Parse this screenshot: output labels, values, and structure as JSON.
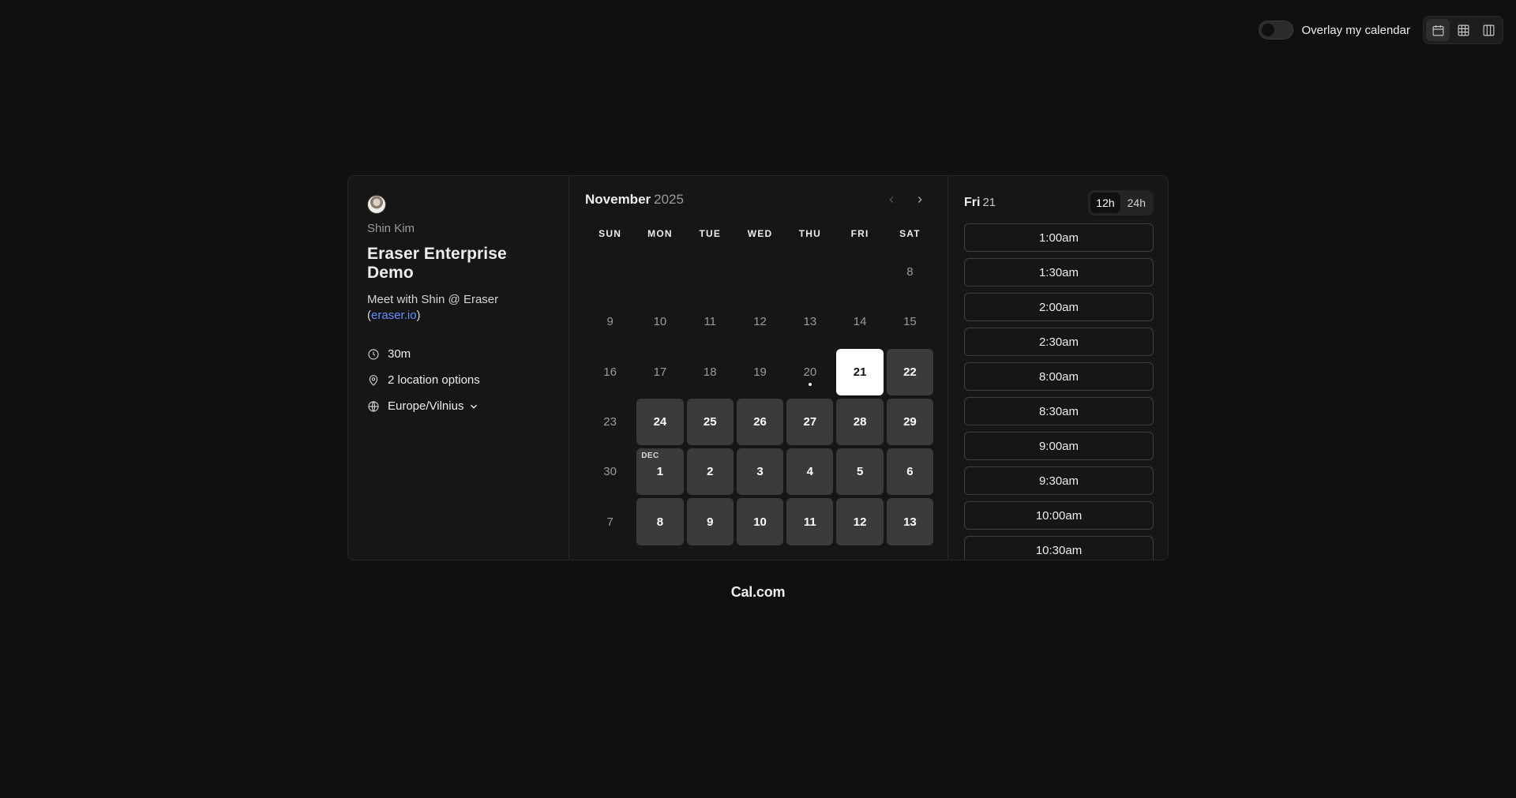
{
  "topbar": {
    "overlay_label": "Overlay my calendar",
    "overlay_enabled": false,
    "views": [
      {
        "icon": "calendar-icon",
        "active": true
      },
      {
        "icon": "grid-icon",
        "active": false
      },
      {
        "icon": "columns-icon",
        "active": false
      }
    ]
  },
  "meta": {
    "host_name": "Shin Kim",
    "event_title": "Eraser Enterprise Demo",
    "description_text": "Meet with Shin @ Eraser (",
    "description_link": "eraser.io",
    "description_end": ")",
    "duration": "30m",
    "locations": "2 location options",
    "timezone": "Europe/Vilnius"
  },
  "calendar": {
    "month": "November",
    "year": "2025",
    "weekdays": [
      "SUN",
      "MON",
      "TUE",
      "WED",
      "THU",
      "FRI",
      "SAT"
    ],
    "weeks": [
      [
        null,
        null,
        null,
        null,
        null,
        null,
        {
          "d": "8",
          "s": "off"
        }
      ],
      [
        {
          "d": "9",
          "s": "off"
        },
        {
          "d": "10",
          "s": "off"
        },
        {
          "d": "11",
          "s": "off"
        },
        {
          "d": "12",
          "s": "off"
        },
        {
          "d": "13",
          "s": "off"
        },
        {
          "d": "14",
          "s": "off"
        },
        {
          "d": "15",
          "s": "off"
        }
      ],
      [
        {
          "d": "16",
          "s": "off"
        },
        {
          "d": "17",
          "s": "off"
        },
        {
          "d": "18",
          "s": "off"
        },
        {
          "d": "19",
          "s": "off"
        },
        {
          "d": "20",
          "s": "off",
          "today": true
        },
        {
          "d": "21",
          "s": "selected"
        },
        {
          "d": "22",
          "s": "available"
        }
      ],
      [
        {
          "d": "23",
          "s": "off"
        },
        {
          "d": "24",
          "s": "available"
        },
        {
          "d": "25",
          "s": "available"
        },
        {
          "d": "26",
          "s": "available"
        },
        {
          "d": "27",
          "s": "available"
        },
        {
          "d": "28",
          "s": "available"
        },
        {
          "d": "29",
          "s": "available"
        }
      ],
      [
        {
          "d": "30",
          "s": "off"
        },
        {
          "d": "1",
          "s": "available",
          "tag": "DEC"
        },
        {
          "d": "2",
          "s": "available"
        },
        {
          "d": "3",
          "s": "available"
        },
        {
          "d": "4",
          "s": "available"
        },
        {
          "d": "5",
          "s": "available"
        },
        {
          "d": "6",
          "s": "available"
        }
      ],
      [
        {
          "d": "7",
          "s": "off"
        },
        {
          "d": "8",
          "s": "available"
        },
        {
          "d": "9",
          "s": "available"
        },
        {
          "d": "10",
          "s": "available"
        },
        {
          "d": "11",
          "s": "available"
        },
        {
          "d": "12",
          "s": "available"
        },
        {
          "d": "13",
          "s": "available"
        }
      ]
    ]
  },
  "slots": {
    "day_name": "Fri",
    "day_num": "21",
    "format_options": [
      "12h",
      "24h"
    ],
    "format_selected": "12h",
    "times": [
      "1:00am",
      "1:30am",
      "2:00am",
      "2:30am",
      "8:00am",
      "8:30am",
      "9:00am",
      "9:30am",
      "10:00am",
      "10:30am"
    ]
  },
  "footer": {
    "brand": "Cal.com"
  }
}
